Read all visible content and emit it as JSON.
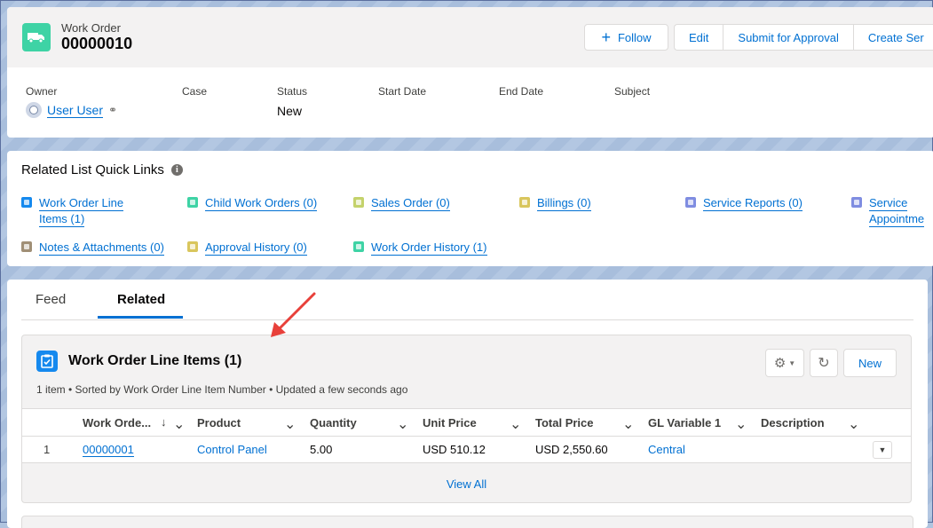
{
  "record": {
    "type": "Work Order",
    "name": "00000010",
    "follow_label": "Follow",
    "actions": [
      "Edit",
      "Submit for Approval",
      "Create Ser"
    ]
  },
  "fields": {
    "owner_label": "Owner",
    "owner_value": "User User",
    "case_label": "Case",
    "status_label": "Status",
    "status_value": "New",
    "start_label": "Start Date",
    "end_label": "End Date",
    "subject_label": "Subject"
  },
  "quick_links": {
    "title": "Related List Quick Links",
    "items": [
      {
        "label": "Work Order Line Items (1)",
        "color": "#1589ee"
      },
      {
        "label": "Child Work Orders (0)",
        "color": "#3ed3a5"
      },
      {
        "label": "Sales Order (0)",
        "color": "#c4d26b"
      },
      {
        "label": "Billings (0)",
        "color": "#d9c65d"
      },
      {
        "label": "Service Reports (0)",
        "color": "#7f8de1"
      },
      {
        "label": "Service Appointme",
        "color": "#7f8de1"
      },
      {
        "label": "Notes & Attachments (0)",
        "color": "#a08f76"
      },
      {
        "label": "Approval History (0)",
        "color": "#d9c65d"
      },
      {
        "label": "Work Order History (1)",
        "color": "#3ed3a5"
      }
    ],
    "item1_line1": "Work Order Line",
    "item1_line2": "Items (1)",
    "item6_line1": "Service",
    "item6_line2": "Appointme"
  },
  "tabs": {
    "feed": "Feed",
    "related": "Related"
  },
  "related_list": {
    "title": "Work Order Line Items (1)",
    "meta": "1 item • Sorted by Work Order Line Item Number • Updated a few seconds ago",
    "new_label": "New",
    "columns": [
      "Work Orde...",
      "Product",
      "Quantity",
      "Unit Price",
      "Total Price",
      "GL Variable 1",
      "Description"
    ],
    "rows": [
      {
        "num": "1",
        "work_order": "00000001",
        "product": "Control Panel",
        "quantity": "5.00",
        "unit_price": "USD 510.12",
        "total_price": "USD 2,550.60",
        "gl_variable": "Central",
        "description": ""
      }
    ],
    "view_all": "View All"
  },
  "colors": {
    "brand": "#0070d2",
    "work_order_icon": "#3ed3a5",
    "annotation_arrow": "#e8403a"
  }
}
